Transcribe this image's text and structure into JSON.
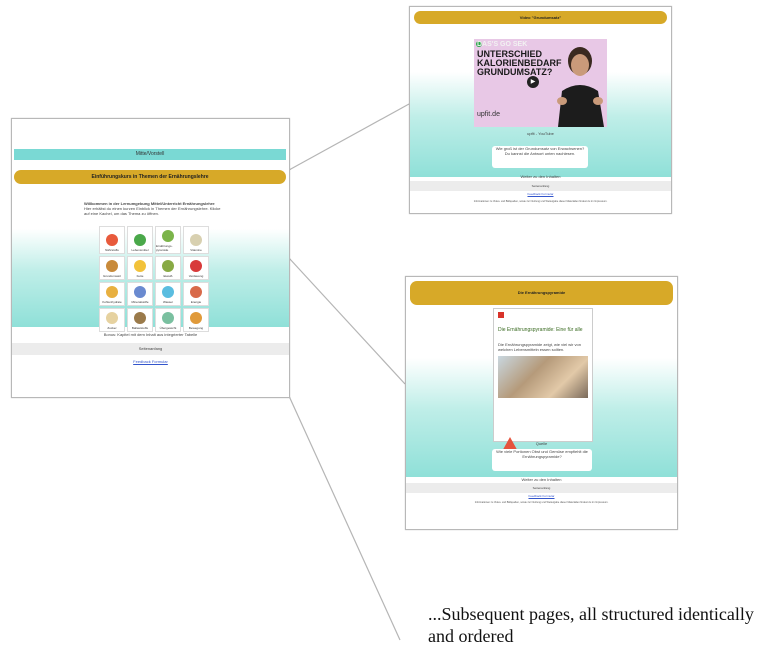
{
  "main_page": {
    "top_bar": "Mitte/Vorstell",
    "title_bar": "Einführungskurs in Themen der Ernährungslehre",
    "intro_heading": "Willkommen in der Lernumgebung Mittel/Unterricht Ernährungslehre",
    "intro_text": "Hier erhältst du einen kurzen Einblick in Themen der Ernährungslehre. Klicke auf eine Kachel, um das Thema zu öffnen.",
    "tiles": [
      {
        "label": "Nährstoffe",
        "color": "#e85a3c"
      },
      {
        "label": "Lebensmittel",
        "color": "#4aa84a"
      },
      {
        "label": "Ernährungs-pyramide",
        "color": "#7bb44a"
      },
      {
        "label": "Vitamine",
        "color": "#d8d0b0"
      },
      {
        "label": "Grundumsatz",
        "color": "#c88a3a"
      },
      {
        "label": "Fette",
        "color": "#f2c23a"
      },
      {
        "label": "Eiweiß",
        "color": "#88aa44"
      },
      {
        "label": "Verdauung",
        "color": "#d83a3a"
      },
      {
        "label": "Kohlenhydrate",
        "color": "#e8b040"
      },
      {
        "label": "Mineralstoffe",
        "color": "#6a8ad0"
      },
      {
        "label": "Wasser",
        "color": "#5abde0"
      },
      {
        "label": "Energie",
        "color": "#d86a4a"
      },
      {
        "label": "Zucker",
        "color": "#e6d2a0"
      },
      {
        "label": "Ballaststoffe",
        "color": "#9a7a4a"
      },
      {
        "label": "Übergewicht",
        "color": "#7ac0a0"
      },
      {
        "label": "Bewegung",
        "color": "#e09a3a"
      }
    ],
    "below_text": "Bonus: Kapitel mit dem Inhalt aus integrierter Tabelle",
    "footer": "Seitenanfang",
    "feedback": "Feedback Formular"
  },
  "video_page": {
    "title_bar": "Video \"Grundumsatz\"",
    "thumb_headline": "UNTERSCHIED KALORIENBEDARF GRUNDUMSATZ?",
    "thumb_faded": "DAS'S GO SEK",
    "thumb_brand": "upfit.de",
    "caption": "upfit - YouTube",
    "question": "Wie groß ist der Grundumsatz von Erwachsenen?",
    "answer_hint": "Du kannst die Antwort unten nachlesen.",
    "below": "Weiter zu den Inhalten",
    "footer": "Seitenanfang",
    "feedback": "Feedback Formular",
    "foot_note": "Informationen zu Video- und Bildquellen, sowie zur Nutzung und Weitergabe dieser Materialien findest du im Impressum."
  },
  "pyramid_page": {
    "title_bar": "Die Ernährungspyramide",
    "doc_title": "Die Ernährungspyramide: Eine für alle",
    "doc_text": "Die Ernährungspyramide zeigt, wie viel wir von welchen Lebensmitteln essen sollten.",
    "caption": "Quelle",
    "question": "Wie viele Portionen Obst und Gemüse empfiehlt die Ernährungspyramide?",
    "below": "Weiter zu den Inhalten",
    "footer": "Seitenanfang",
    "feedback": "Feedback Formular",
    "foot_note": "Informationen zu Video- und Bildquellen, sowie zur Nutzung und Weitergabe dieser Materialien findest du im Impressum."
  },
  "caption": "...Subsequent pages, all structured identically and ordered"
}
